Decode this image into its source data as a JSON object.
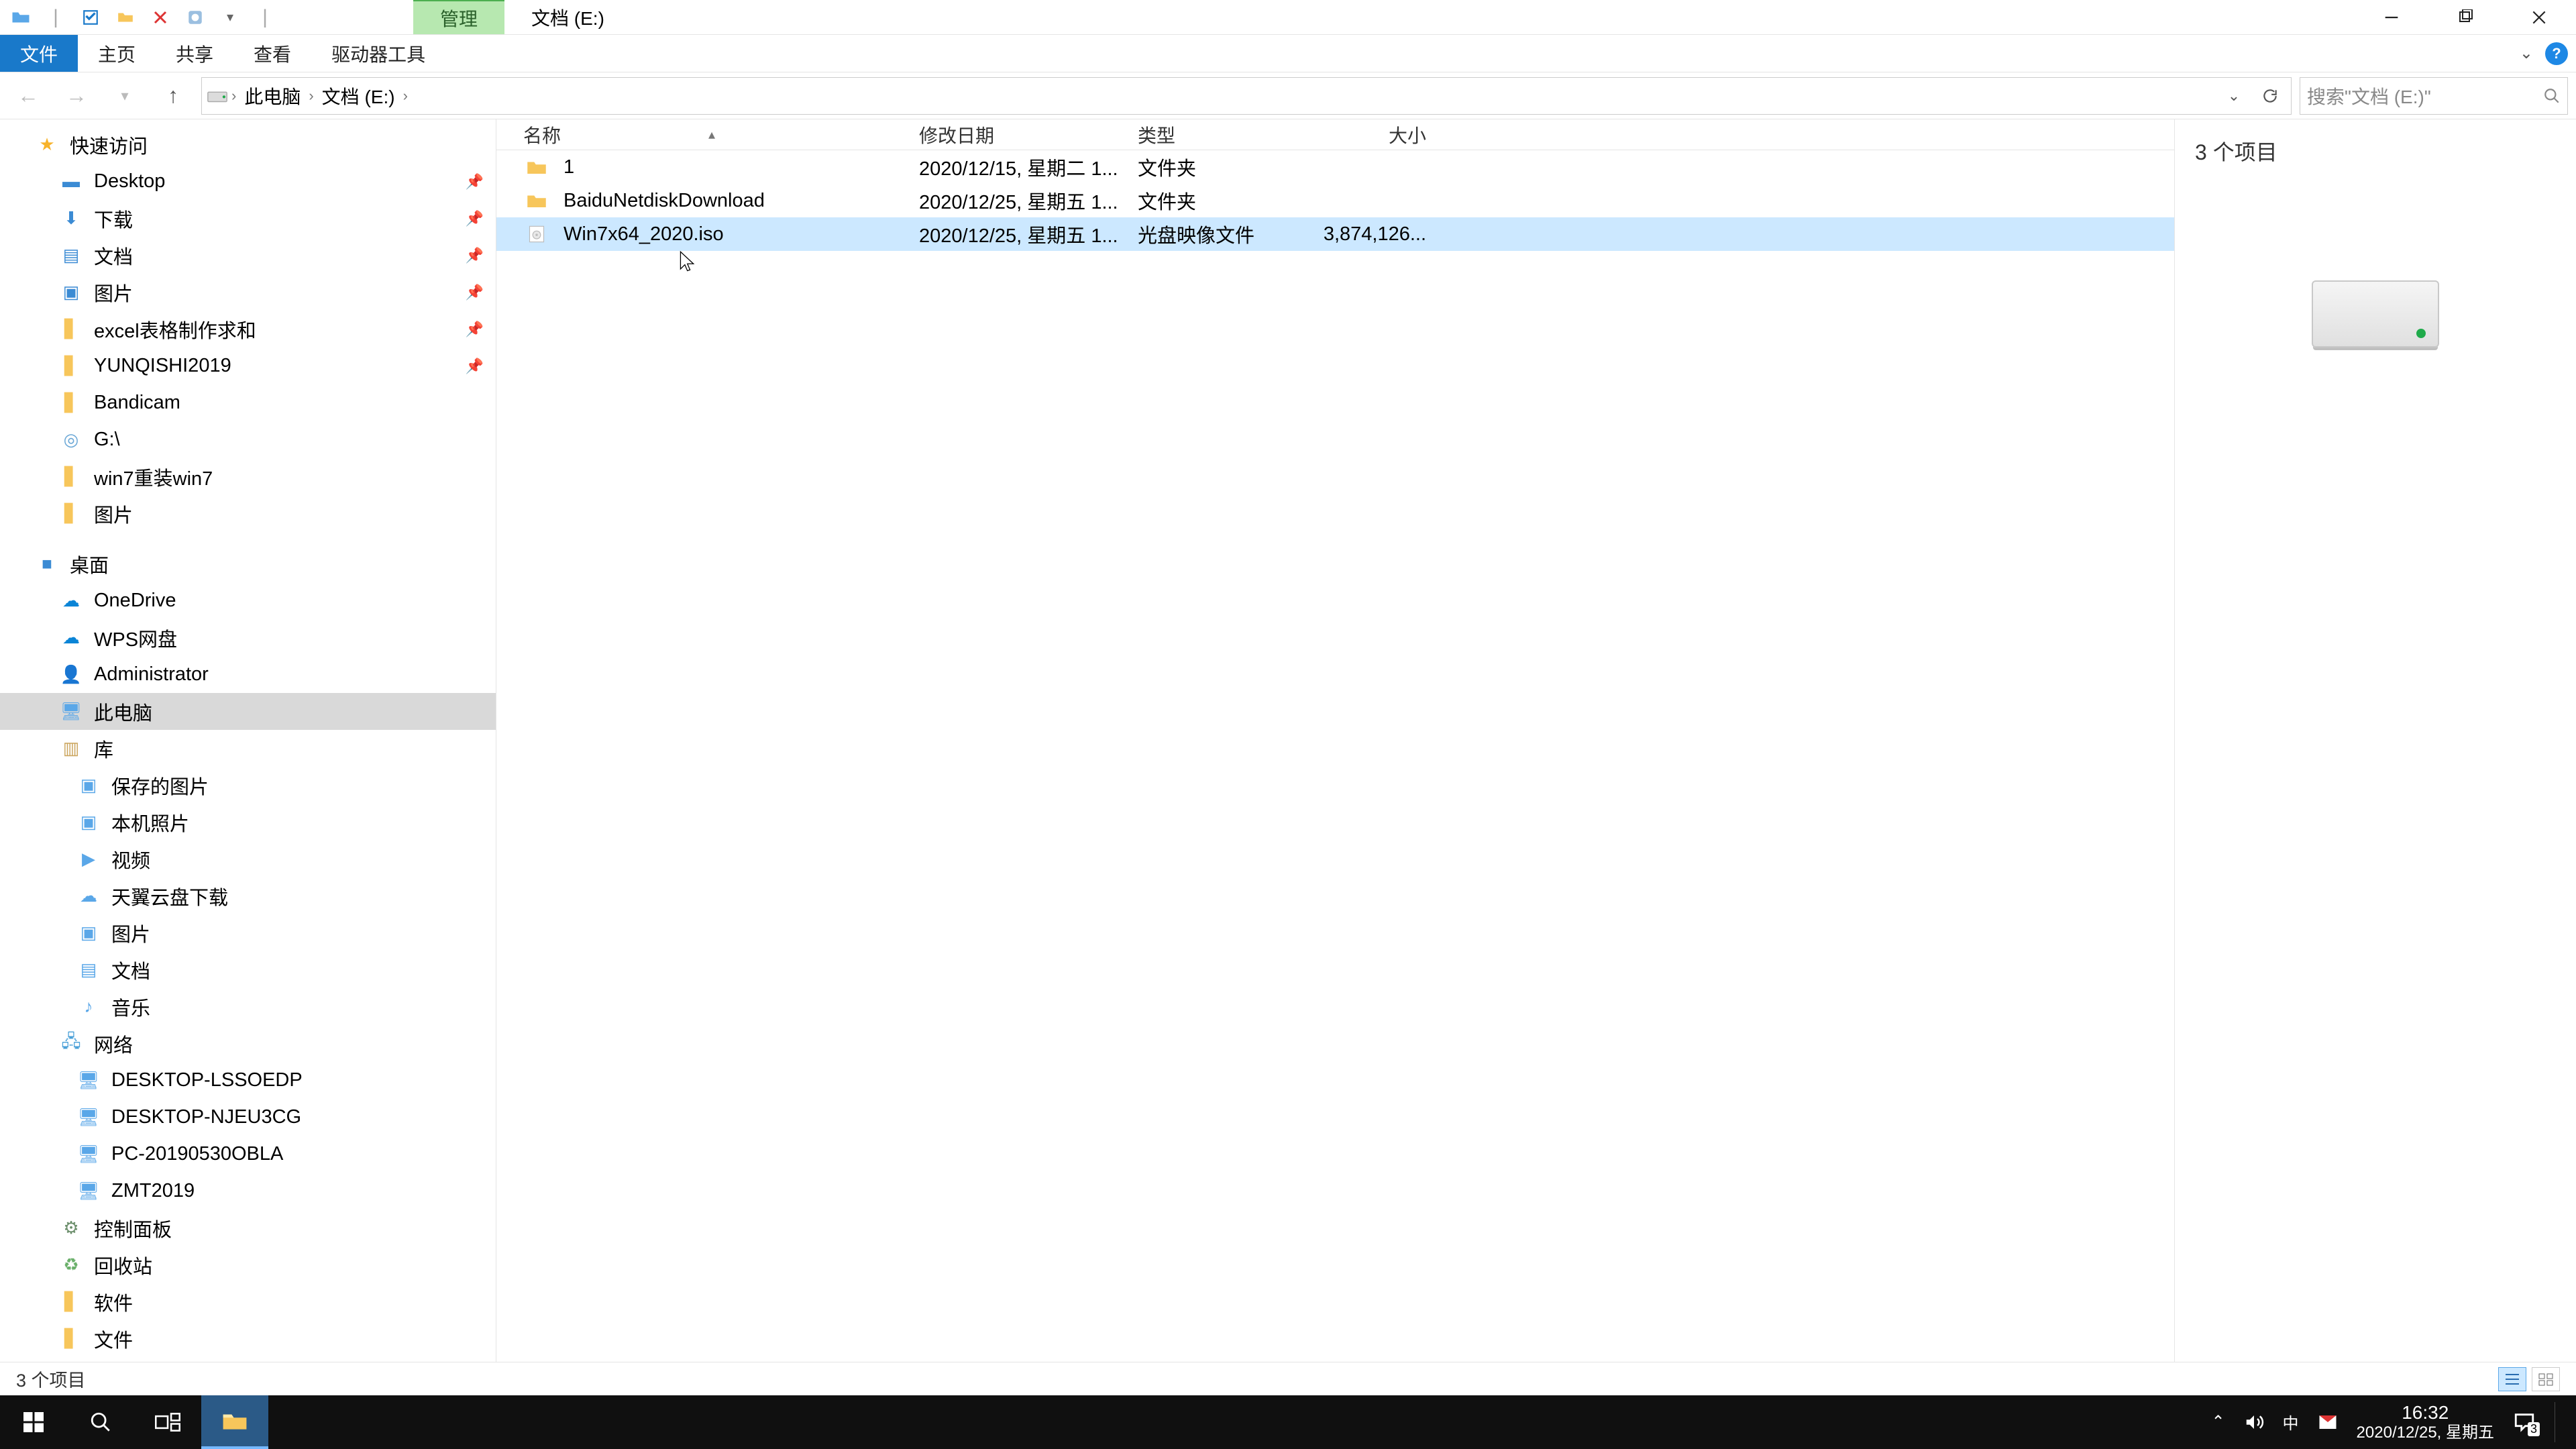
{
  "titlebar": {
    "manage_tab": "管理",
    "location": "文档 (E:)"
  },
  "ribbon": {
    "file": "文件",
    "home": "主页",
    "share": "共享",
    "view": "查看",
    "drive_tools": "驱动器工具"
  },
  "breadcrumbs": {
    "this_pc": "此电脑",
    "location": "文档 (E:)"
  },
  "address": {
    "refresh_icon": "refresh-icon"
  },
  "search": {
    "placeholder": "搜索\"文档 (E:)\""
  },
  "columns": {
    "name": "名称",
    "date": "修改日期",
    "type": "类型",
    "size": "大小"
  },
  "files": [
    {
      "icon": "folder",
      "name": "1",
      "date": "2020/12/15, 星期二 1...",
      "type": "文件夹",
      "size": "",
      "selected": false
    },
    {
      "icon": "folder",
      "name": "BaiduNetdiskDownload",
      "date": "2020/12/25, 星期五 1...",
      "type": "文件夹",
      "size": "",
      "selected": false
    },
    {
      "icon": "disc",
      "name": "Win7x64_2020.iso",
      "date": "2020/12/25, 星期五 1...",
      "type": "光盘映像文件",
      "size": "3,874,126...",
      "selected": true
    }
  ],
  "tree": {
    "quick_access": "快速访问",
    "desktop": "Desktop",
    "downloads": "下载",
    "documents": "文档",
    "pictures": "图片",
    "excel_reqs": "excel表格制作求和",
    "yunqishi": "YUNQISHI2019",
    "bandicam": "Bandicam",
    "g_drive": "G:\\",
    "win7_reinstall": "win7重装win7",
    "pictures2": "图片",
    "desktop_cn": "桌面",
    "onedrive": "OneDrive",
    "wps": "WPS网盘",
    "administrator": "Administrator",
    "this_pc": "此电脑",
    "libraries": "库",
    "saved_pictures": "保存的图片",
    "camera_roll": "本机照片",
    "videos": "视频",
    "tianyi": "天翼云盘下载",
    "pictures_lib": "图片",
    "documents_lib": "文档",
    "music": "音乐",
    "network": "网络",
    "pc1": "DESKTOP-LSSOEDP",
    "pc2": "DESKTOP-NJEU3CG",
    "pc3": "PC-20190530OBLA",
    "pc4": "ZMT2019",
    "cpanel": "控制面板",
    "recycle": "回收站",
    "software": "软件",
    "files_folder": "文件"
  },
  "preview": {
    "count_label": "3 个项目"
  },
  "statusbar": {
    "count": "3 个项目"
  },
  "taskbar": {
    "time": "16:32",
    "date": "2020/12/25, 星期五",
    "ime": "中",
    "notif_count": "3"
  },
  "icon_colors": {
    "star": "#f7b32b",
    "folder": "#f7c65b",
    "blue_folder": "#3b8bd4",
    "drive": "#6aa7d6",
    "cloud_blue": "#0a84d6",
    "lib": "#caa35a",
    "net": "#4aa0d8",
    "panel": "#6b8e6b",
    "recycle": "#6bb06b",
    "monitor": "#5aa7e8"
  }
}
